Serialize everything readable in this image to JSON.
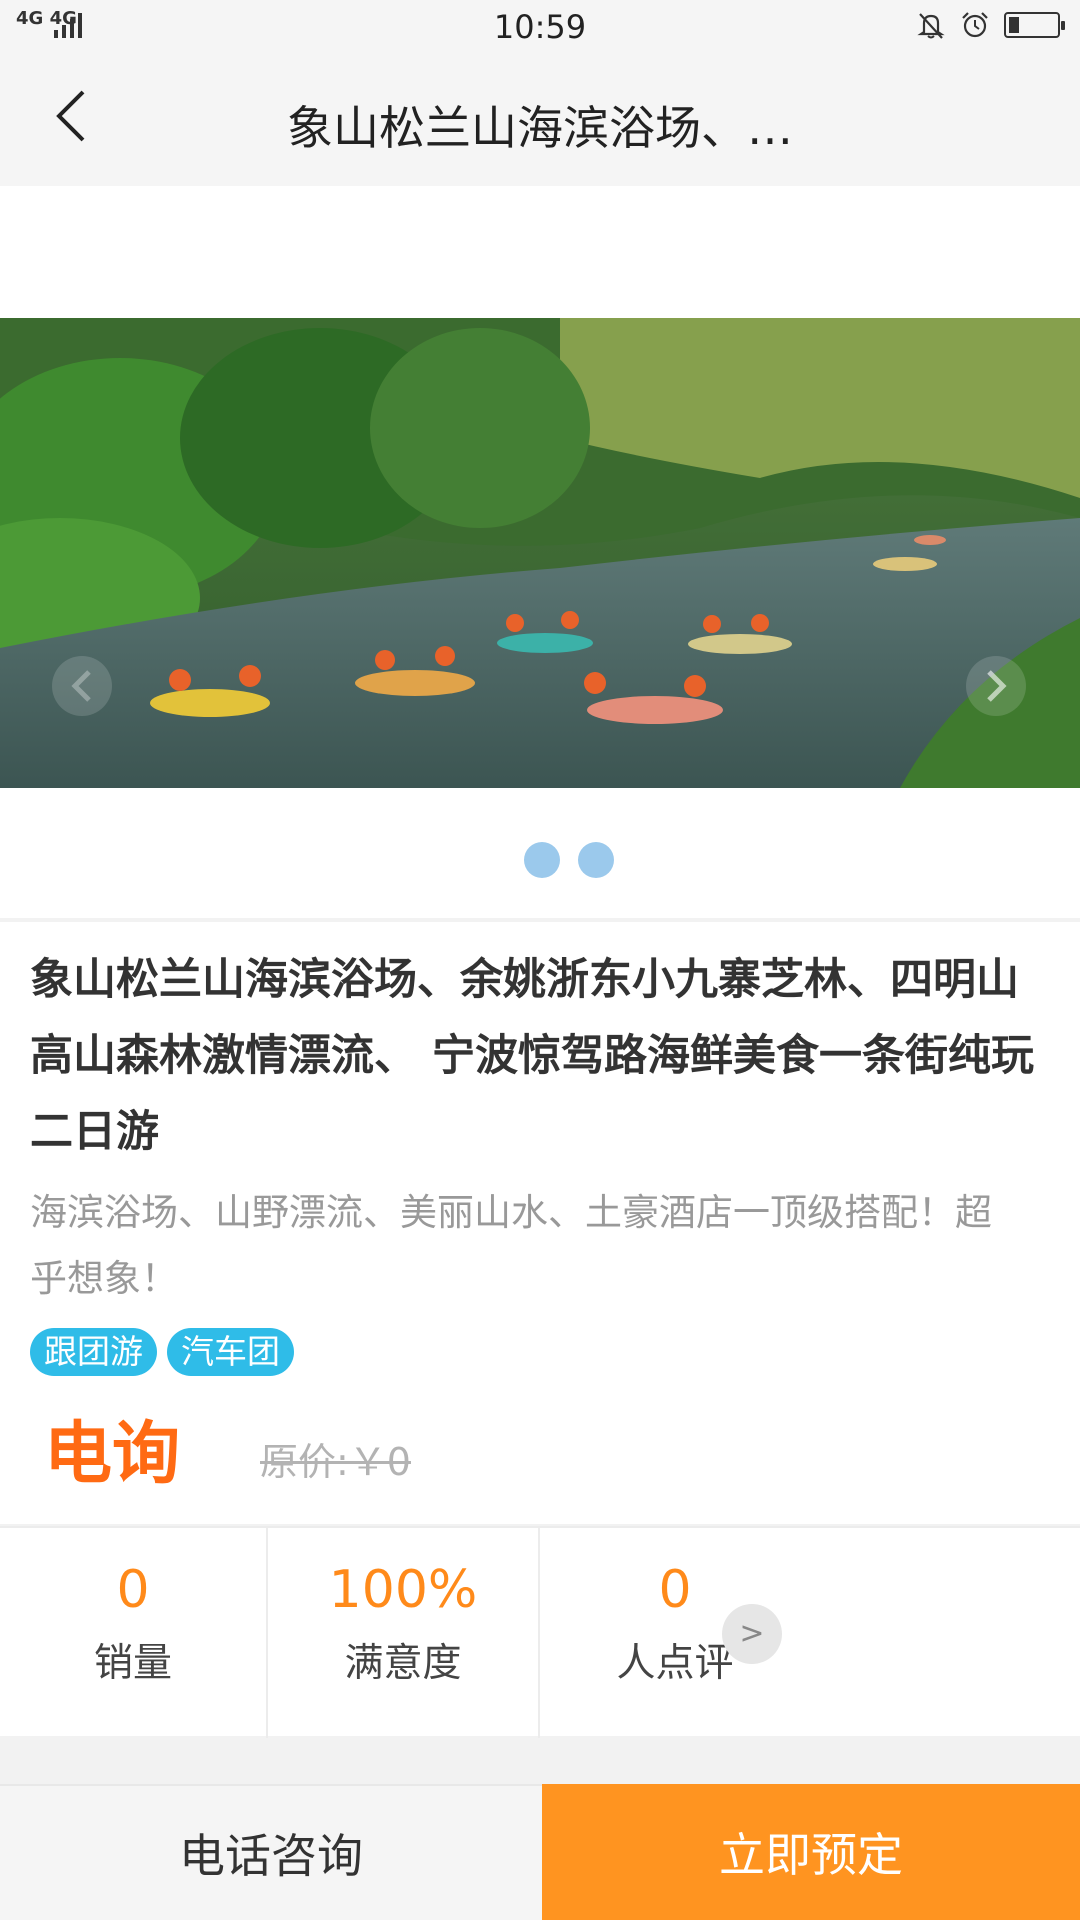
{
  "status_bar": {
    "network": "4G 4G",
    "time": "10:59",
    "icons": [
      "mute-bell-icon",
      "alarm-icon",
      "battery-icon"
    ],
    "battery_level": 0.2
  },
  "header": {
    "back_icon": "chevron-left-icon",
    "title": "象山松兰山海滨浴场、…"
  },
  "carousel": {
    "image_description_icon": "river-rafting-photo",
    "dots_count": 2,
    "dot_color": "#9bc9ec"
  },
  "product": {
    "title": "象山松兰山海滨浴场、余姚浙东小九寨芝林、四明山高山森林激情漂流、 宁波惊驾路海鲜美食一条街纯玩二日游",
    "subtitle": "海滨浴场、山野漂流、美丽山水、土豪酒店一顶级搭配！超乎想象！",
    "tags": [
      "跟团游",
      "汽车团"
    ],
    "price": "电询",
    "original_price": "原价:￥0"
  },
  "stats": [
    {
      "value": "0",
      "label": "销量"
    },
    {
      "value": "100%",
      "label": "满意度"
    },
    {
      "value": "0",
      "label": "人点评"
    }
  ],
  "stats_chevron": ">",
  "bottom_bar": {
    "call_label": "电话咨询",
    "book_label": "立即预定"
  },
  "colors": {
    "accent_orange": "#ff9420",
    "price_orange": "#ff6a13",
    "tag_blue": "#2fbce8"
  }
}
